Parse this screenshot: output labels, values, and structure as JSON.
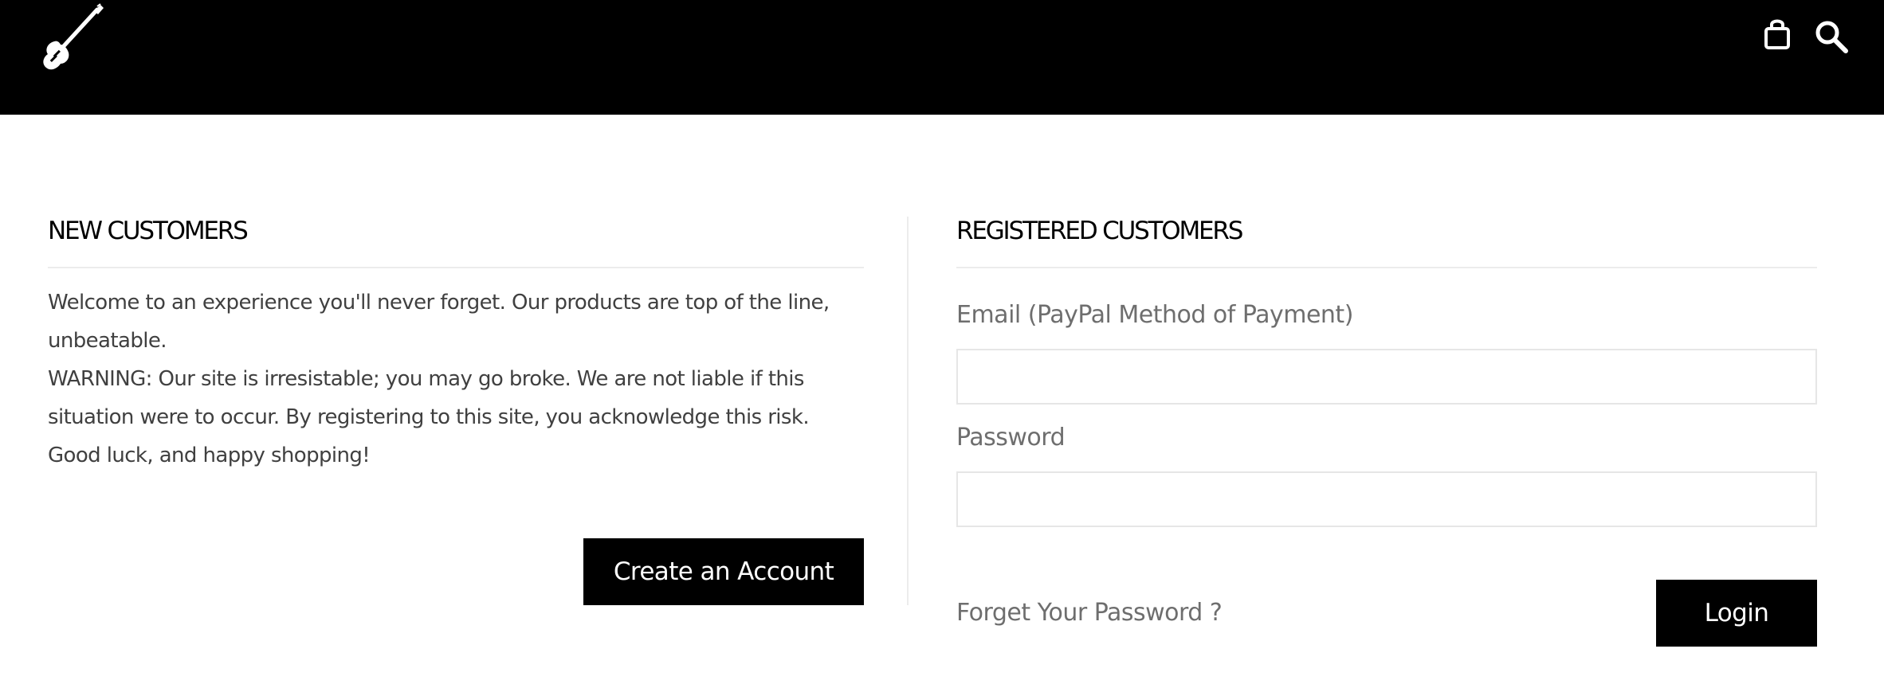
{
  "header": {
    "logo_icon": "electric-guitar-icon",
    "cart_icon": "shopping-bag-icon",
    "search_icon": "search-icon",
    "background_color": "#000000"
  },
  "new_customers": {
    "title": "NEW CUSTOMERS",
    "paragraphs": [
      "Welcome to an experience you'll never forget. Our products are top of the line, unbeatable.",
      "WARNING: Our site is irresistable; you may go broke. We are not liable if this situation were to occur. By registering to this site, you acknowledge this risk.",
      "Good luck, and happy shopping!"
    ],
    "create_account_label": "Create an Account"
  },
  "registered_customers": {
    "title": "REGISTERED CUSTOMERS",
    "email_label": "Email (PayPal Method of Payment)",
    "email_value": "",
    "password_label": "Password",
    "password_value": "",
    "forgot_password_label": "Forget Your Password ?",
    "login_label": "Login"
  },
  "colors": {
    "button_background": "#000000",
    "button_text": "#ffffff",
    "label_text": "#6e6e6e",
    "body_text": "#404040"
  }
}
